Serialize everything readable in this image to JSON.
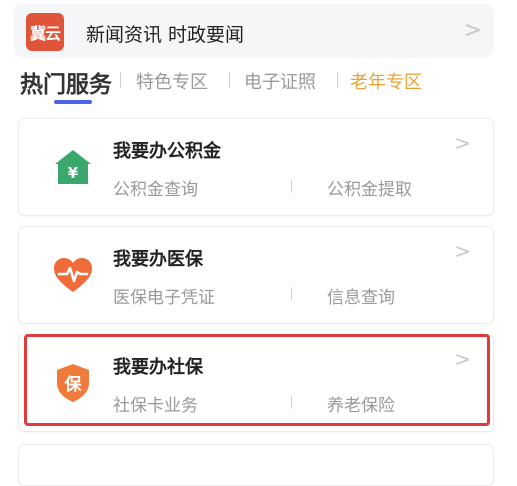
{
  "news": {
    "logo_text": "冀云",
    "title": "新闻资讯 时政要闻",
    "arrow": ">"
  },
  "tabs": [
    {
      "label": "热门服务",
      "active": true
    },
    {
      "label": "特色专区"
    },
    {
      "label": "电子证照"
    },
    {
      "label": "老年专区"
    }
  ],
  "colors": {
    "tab_underline": "#4d63e6",
    "elderly_tab": "#e8a535",
    "highlight_border": "#e03a3a",
    "fund_icon": "#3aa76d",
    "medical_icon": "#f06a3a",
    "social_icon": "#ef7a3a"
  },
  "services": [
    {
      "icon": "house-yuan-icon",
      "title": "我要办公积金",
      "left_action": "公积金查询",
      "right_action": "公积金提取",
      "arrow": ">"
    },
    {
      "icon": "heart-pulse-icon",
      "title": "我要办医保",
      "left_action": "医保电子凭证",
      "right_action": "信息查询",
      "arrow": ">"
    },
    {
      "icon": "shield-bao-icon",
      "icon_glyph": "保",
      "title": "我要办社保",
      "left_action": "社保卡业务",
      "right_action": "养老保险",
      "arrow": ">",
      "highlighted": true
    }
  ]
}
